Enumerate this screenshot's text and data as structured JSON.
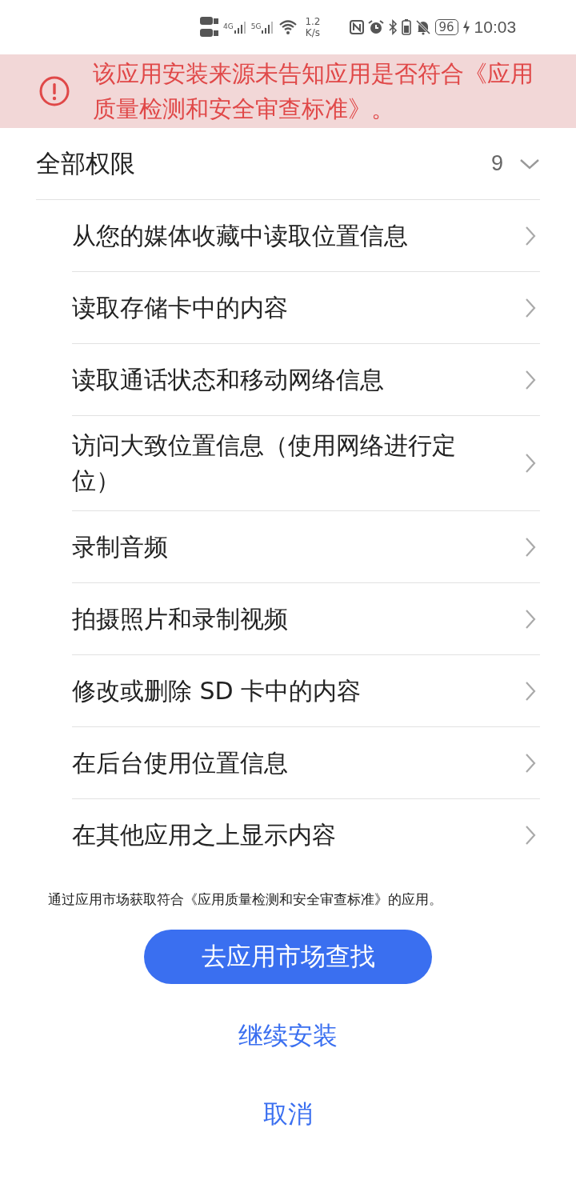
{
  "status_bar": {
    "network_labels": [
      "4G",
      "5G"
    ],
    "speed_value": "1.2",
    "speed_unit": "K/s",
    "battery": "96",
    "time": "10:03"
  },
  "warning": {
    "text": "该应用安装来源未告知应用是否符合《应用质量检测和安全审查标准》。"
  },
  "permissions": {
    "title": "全部权限",
    "count": "9",
    "expanded": true,
    "items": [
      {
        "label": "从您的媒体收藏中读取位置信息"
      },
      {
        "label": "读取存储卡中的内容"
      },
      {
        "label": "读取通话状态和移动网络信息"
      },
      {
        "label": "访问大致位置信息（使用网络进行定位）"
      },
      {
        "label": "录制音频"
      },
      {
        "label": "拍摄照片和录制视频"
      },
      {
        "label": "修改或删除 SD 卡中的内容"
      },
      {
        "label": "在后台使用位置信息"
      },
      {
        "label": "在其他应用之上显示内容"
      }
    ]
  },
  "note": "通过应用市场获取符合《应用质量检测和安全审查标准》的应用。",
  "buttons": {
    "primary": "去应用市场查找",
    "continue": "继续安装",
    "cancel": "取消"
  }
}
